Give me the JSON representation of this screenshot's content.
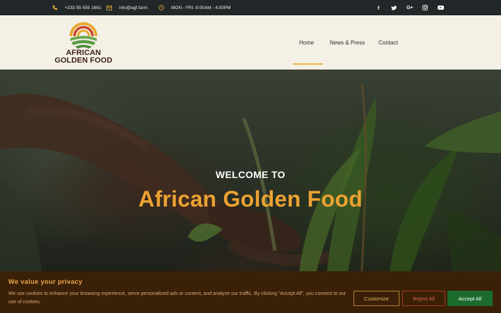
{
  "topbar": {
    "phone": "+233 55 555 1661",
    "email": "info@agf.farm",
    "hours": "MON - FRI: 8:00AM - 4:00PM",
    "phone_icon": "phone-icon",
    "email_icon": "envelope-icon",
    "hours_icon": "clock-icon",
    "social": [
      {
        "name": "facebook-icon",
        "glyph": "f"
      },
      {
        "name": "twitter-icon",
        "glyph": "🐦"
      },
      {
        "name": "google-plus-icon",
        "glyph": "G+"
      },
      {
        "name": "instagram-icon",
        "glyph": "◎"
      },
      {
        "name": "youtube-icon",
        "glyph": ""
      }
    ]
  },
  "header": {
    "logo_line1": "AFRICAN",
    "logo_line2": "GOLDEN FOOD",
    "nav": [
      {
        "label": "Home",
        "active": true
      },
      {
        "label": "News & Press",
        "active": false
      },
      {
        "label": "Contact",
        "active": false
      }
    ]
  },
  "hero": {
    "pretitle": "WELCOME TO",
    "title": "African Golden Food"
  },
  "cookie": {
    "title": "We value your privacy",
    "text": "We use cookies to enhance your browsing experience, serve personalized ads or content, and analyze our traffic. By clicking \"Accept All\", you consent to our use of cookies.",
    "customize_label": "Customize",
    "reject_label": "Reject All",
    "accept_label": "Accept All"
  },
  "colors": {
    "accent": "#e6b23c",
    "title_orange": "#eda232",
    "accept_green": "#1b6b2d",
    "topbar_bg": "#222829",
    "header_bg": "#f4f0e6",
    "cookie_bg": "#3b2008"
  }
}
